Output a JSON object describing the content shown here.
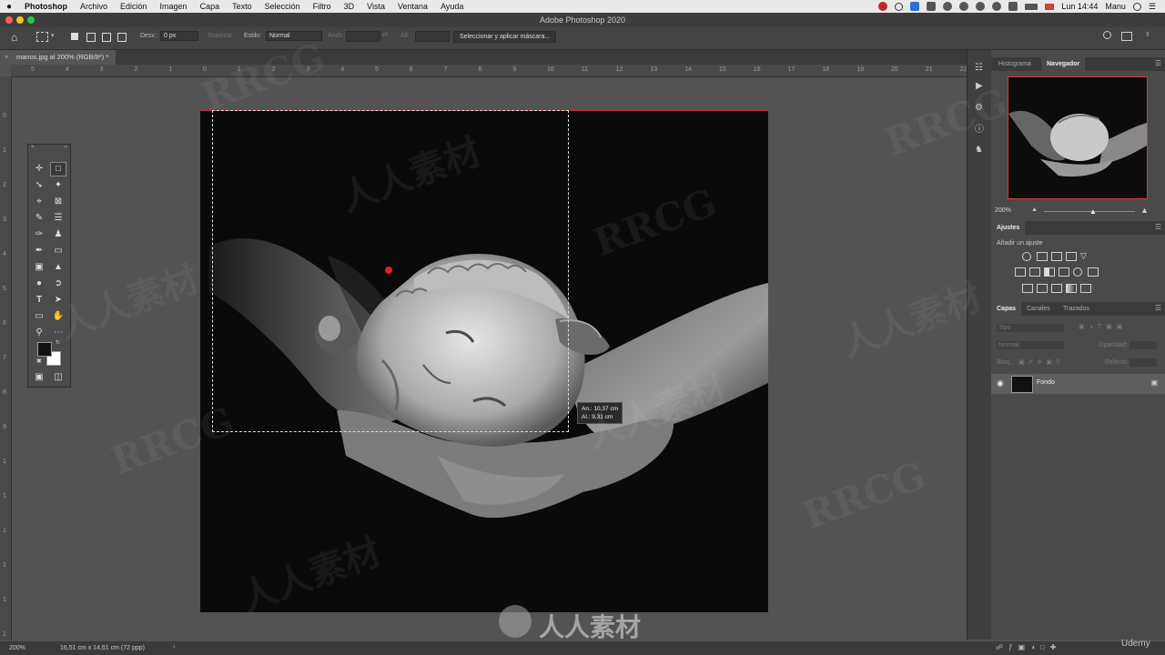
{
  "menubar": {
    "app_name": "Photoshop",
    "items": [
      "Archivo",
      "Edición",
      "Imagen",
      "Capa",
      "Texto",
      "Selección",
      "Filtro",
      "3D",
      "Vista",
      "Ventana",
      "Ayuda"
    ],
    "clock": "Lun 14:44",
    "user": "Manu"
  },
  "window": {
    "title": "Adobe Photoshop 2020"
  },
  "options_bar": {
    "feather_label": "Desv.:",
    "feather_value": "0 px",
    "antialias_label": "Suavizar",
    "style_label": "Estilo:",
    "style_value": "Normal",
    "width_label": "Anch.:",
    "height_label": "Alt.:",
    "select_mask_button": "Seleccionar y aplicar máscara..."
  },
  "document": {
    "tab_label": "manos.jpg al 200% (RGB/8*) *",
    "measure_width": "An.: 10,37 cm",
    "measure_height": "Al.: 9,31 cm"
  },
  "rulers": {
    "h_ticks": [
      "5",
      "4",
      "3",
      "2",
      "1",
      "0",
      "1",
      "2",
      "3",
      "4",
      "5",
      "6",
      "7",
      "8",
      "9",
      "10",
      "11",
      "12",
      "13",
      "14",
      "15",
      "16",
      "17",
      "18",
      "19",
      "20",
      "21",
      "22"
    ],
    "v_ticks": [
      "0",
      "1",
      "2",
      "3",
      "4",
      "5",
      "6",
      "7",
      "8",
      "9",
      "1",
      "1",
      "1",
      "1",
      "1",
      "1"
    ]
  },
  "navigator_panel": {
    "tabs": [
      "Histograma",
      "Navegador"
    ],
    "active_tab": "Navegador",
    "zoom": "200%"
  },
  "adjustments_panel": {
    "title": "Ajustes",
    "subtitle": "Añadir un ajuste"
  },
  "layers_panel": {
    "tabs": [
      "Capas",
      "Canales",
      "Trazados"
    ],
    "active_tab": "Capas",
    "filter_placeholder": "Tipo",
    "blend_mode": "Normal",
    "opacity_label": "Opacidad:",
    "lock_label": "Bloq.:",
    "fill_label": "Relleno:",
    "layers": [
      {
        "name": "Fondo",
        "visible": true,
        "locked": true
      }
    ]
  },
  "status_bar": {
    "zoom": "200%",
    "doc_info": "16,51 cm x 14,61 cm (72 ppp)"
  },
  "watermarks": [
    "RRCG",
    "人人素材",
    "Udemy"
  ],
  "colors": {
    "accent_red": "#d23a3a",
    "foreground_swatch": "#111111",
    "background_swatch": "#ffffff"
  }
}
